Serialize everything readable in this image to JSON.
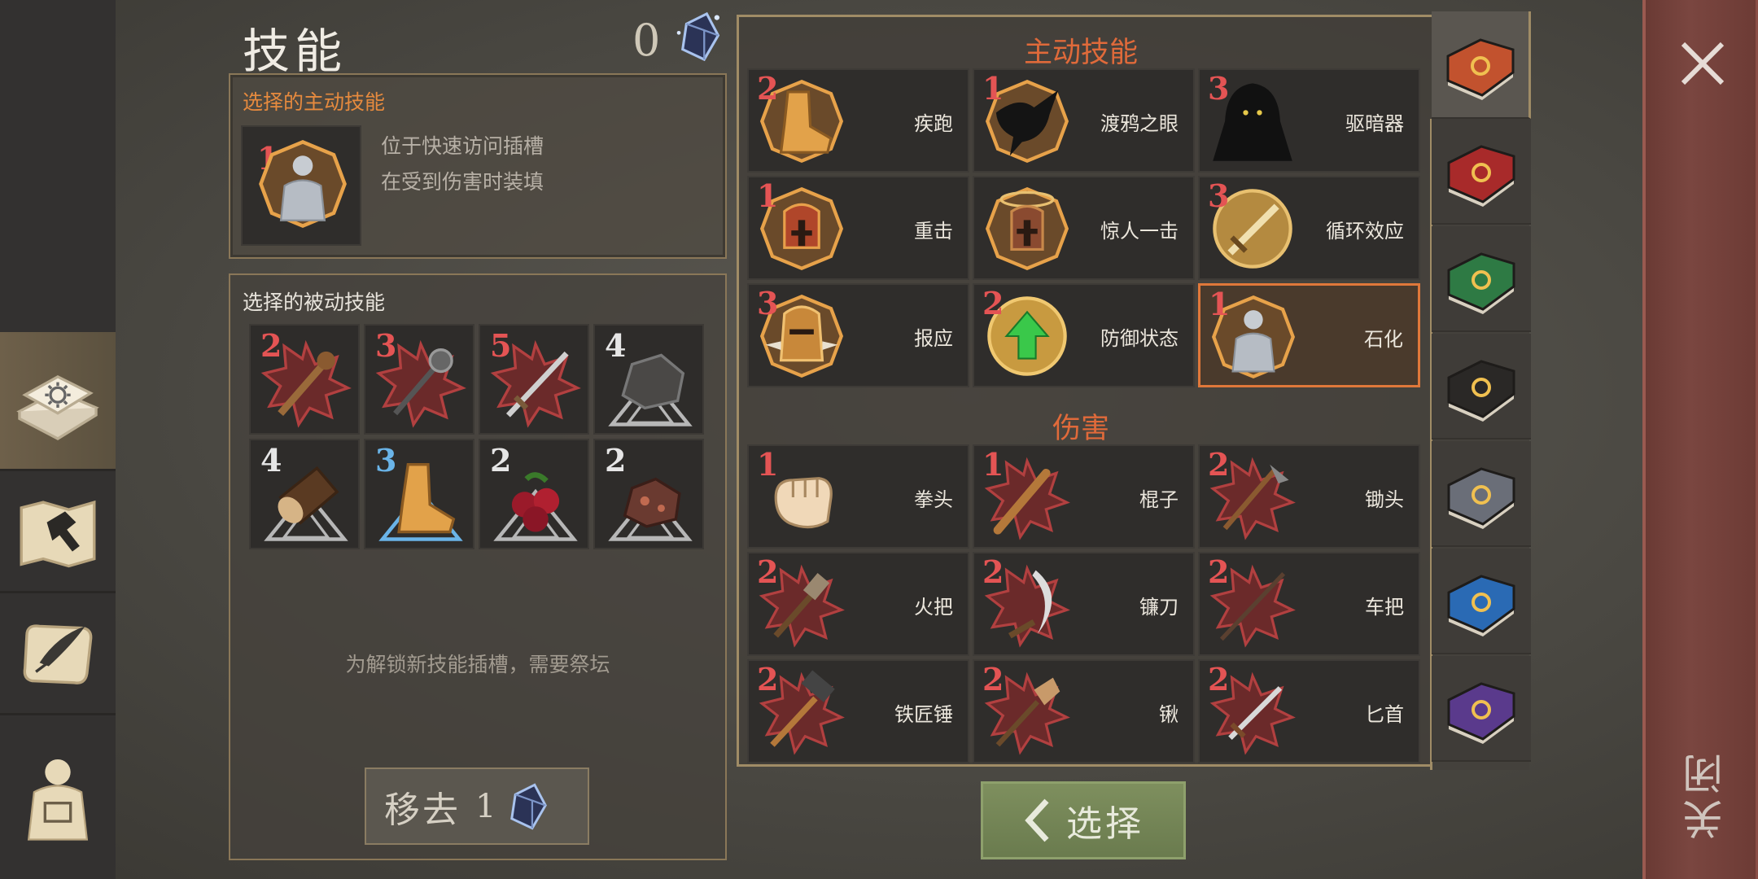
{
  "header": {
    "title": "技能",
    "gem_count": "0"
  },
  "left_tabs": [
    {
      "name": "skills-book-tab",
      "icon": "sun-book-icon",
      "selected": true
    },
    {
      "name": "crafting-tab",
      "icon": "hammer-map-icon",
      "selected": false
    },
    {
      "name": "quests-tab",
      "icon": "scroll-quill-icon",
      "selected": false
    },
    {
      "name": "equipment-tab",
      "icon": "character-backpack-icon",
      "selected": false
    }
  ],
  "active_panel": {
    "label": "选择的主动技能",
    "slot_level": "1",
    "slot_icon": "petrify-stone-figure-icon",
    "desc_line1": "位于快速访问插槽",
    "desc_line2": "在受到伤害时装填"
  },
  "passive_panel": {
    "label": "选择的被动技能",
    "items": [
      {
        "level": "2",
        "icon": "spiked-club-icon",
        "level_color": "#e45454"
      },
      {
        "level": "3",
        "icon": "mace-icon",
        "level_color": "#e45454"
      },
      {
        "level": "5",
        "icon": "sword-icon",
        "level_color": "#e45454"
      },
      {
        "level": "4",
        "icon": "stone-icon",
        "level_color": "#e6e6e6"
      },
      {
        "level": "4",
        "icon": "log-icon",
        "level_color": "#e6e6e6"
      },
      {
        "level": "3",
        "icon": "running-boot-icon",
        "level_color": "#6ab4e8"
      },
      {
        "level": "2",
        "icon": "berries-icon",
        "level_color": "#e6e6e6"
      },
      {
        "level": "2",
        "icon": "ore-icon",
        "level_color": "#e6e6e6"
      }
    ],
    "unlock_hint": "为解锁新技能插槽，需要祭坛"
  },
  "remove_button": {
    "label": "移去",
    "cost": "1"
  },
  "active_skills": {
    "title": "主动技能",
    "items": [
      {
        "level": "2",
        "name": "疾跑",
        "icon": "boot-sprint-icon"
      },
      {
        "level": "1",
        "name": "渡鸦之眼",
        "icon": "raven-icon"
      },
      {
        "level": "3",
        "name": "驱暗器",
        "icon": "hooded-figure-icon"
      },
      {
        "level": "1",
        "name": "重击",
        "icon": "helmet-strike-icon"
      },
      {
        "level": "",
        "name": "惊人一击",
        "icon": "helmet-halo-icon"
      },
      {
        "level": "3",
        "name": "循环效应",
        "icon": "sword-loop-icon"
      },
      {
        "level": "3",
        "name": "报应",
        "icon": "spiked-helmet-icon"
      },
      {
        "level": "2",
        "name": "防御状态",
        "icon": "shield-arrow-icon"
      },
      {
        "level": "1",
        "name": "石化",
        "icon": "petrify-stone-figure-icon",
        "selected": true
      }
    ]
  },
  "damage_skills": {
    "title": "伤害",
    "items": [
      {
        "level": "1",
        "name": "拳头",
        "icon": "fist-icon"
      },
      {
        "level": "1",
        "name": "棍子",
        "icon": "club-icon"
      },
      {
        "level": "2",
        "name": "锄头",
        "icon": "hoe-icon"
      },
      {
        "level": "2",
        "name": "火把",
        "icon": "torch-icon"
      },
      {
        "level": "2",
        "name": "镰刀",
        "icon": "sickle-icon"
      },
      {
        "level": "2",
        "name": "车把",
        "icon": "cart-handle-icon"
      },
      {
        "level": "2",
        "name": "铁匠锤",
        "icon": "smith-hammer-icon"
      },
      {
        "level": "2",
        "name": "锹",
        "icon": "shovel-icon"
      },
      {
        "level": "2",
        "name": "匕首",
        "icon": "dagger-icon"
      }
    ]
  },
  "book_tabs": [
    {
      "icon": "sun-book-orange-icon",
      "color": "#c2522e",
      "selected": true
    },
    {
      "icon": "dagger-book-red-icon",
      "color": "#a82a2a"
    },
    {
      "icon": "cross-book-green-icon",
      "color": "#2e7a44"
    },
    {
      "icon": "mask-book-black-icon",
      "color": "#2a2826"
    },
    {
      "icon": "pickaxe-book-gray-icon",
      "color": "#6a6e78"
    },
    {
      "icon": "shield-book-blue-icon",
      "color": "#2a6ab4"
    },
    {
      "icon": "arrows-book-purple-icon",
      "color": "#5a3a8c"
    }
  ],
  "select_button": {
    "label": "选择"
  },
  "close": {
    "label": "关闭"
  }
}
